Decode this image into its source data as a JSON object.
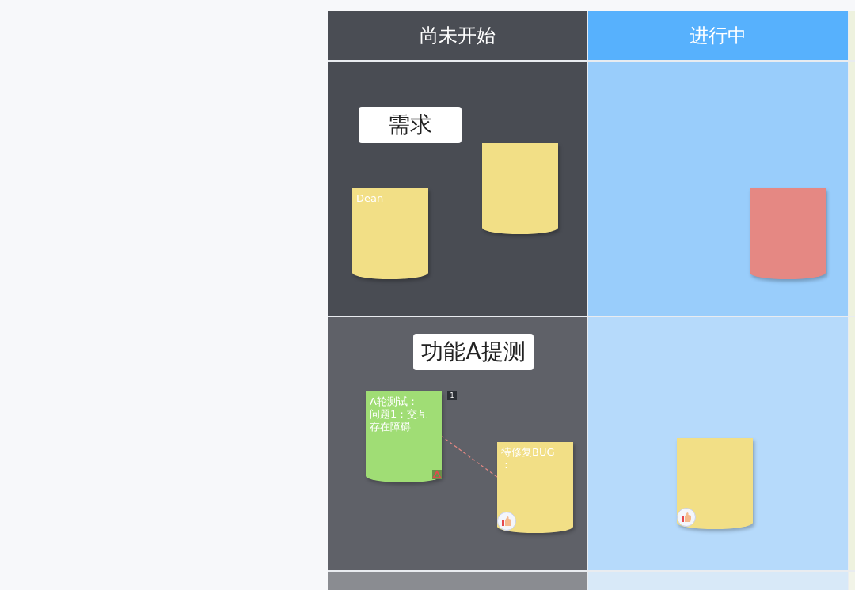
{
  "board": {
    "columns": [
      {
        "kind": "titled",
        "title": "尚未开始"
      },
      {
        "kind": "titled",
        "title": "进行中"
      },
      {
        "kind": "partial"
      }
    ],
    "rows": [
      {
        "kind": "lane",
        "cells": [
          {
            "label": "需求",
            "notes": [
              {
                "kind": "note",
                "color": "#f2df86",
                "text": "Dean",
                "liked": false,
                "flagged": false
              },
              {
                "kind": "note",
                "color": "#f2df86",
                "liked": false,
                "flagged": false
              }
            ]
          },
          {
            "notes": [
              {
                "kind": "note",
                "color": "#e58883",
                "liked": false,
                "flagged": false
              }
            ]
          }
        ]
      },
      {
        "kind": "lane",
        "cells": [
          {
            "label": "功能A提测",
            "link": true,
            "notes": [
              {
                "kind": "note",
                "color": "#a0dd75",
                "lines": [
                  "A轮测试：",
                  "问题1：交互存在障碍"
                ],
                "liked": false,
                "flagged": true,
                "comments": "1"
              },
              {
                "kind": "note",
                "color": "#f2df86",
                "lines": [
                  "待修复BUG",
                  "："
                ],
                "liked": true,
                "flagged": false
              }
            ]
          },
          {
            "notes": [
              {
                "kind": "note",
                "color": "#f2df86",
                "liked": true,
                "flagged": false
              }
            ]
          }
        ]
      },
      {
        "kind": "partial"
      }
    ]
  }
}
